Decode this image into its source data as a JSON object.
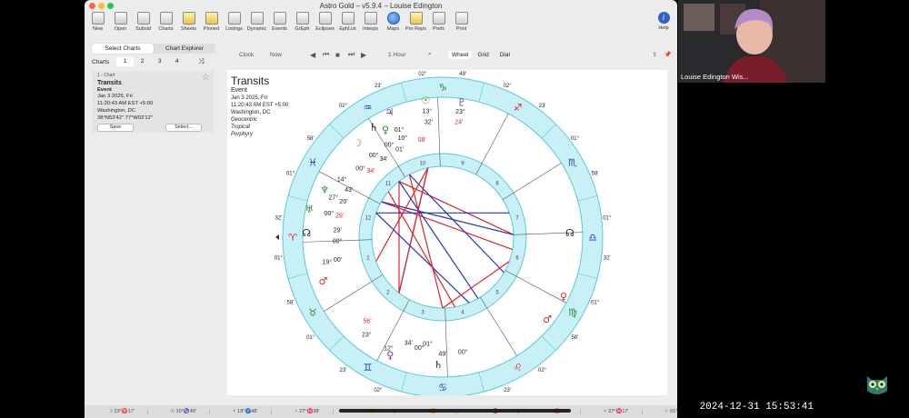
{
  "window": {
    "title": "Astro Gold – v5.9.4 – Louise Edington"
  },
  "toolbar": {
    "items": [
      {
        "label": "New",
        "icon": "new-chart-icon"
      },
      {
        "label": "Open",
        "icon": "open-icon"
      },
      {
        "label": "Subsid",
        "icon": "subsidiary-icon"
      },
      {
        "label": "Charts",
        "icon": "charts-icon"
      },
      {
        "label": "Sheets",
        "icon": "sheets-icon"
      },
      {
        "label": "Pinned",
        "icon": "pin-icon"
      },
      {
        "label": "Listings",
        "icon": "listings-icon"
      },
      {
        "label": "Dynamic",
        "icon": "dynamic-icon"
      },
      {
        "label": "Events",
        "icon": "events-icon"
      },
      {
        "label": "GrEph",
        "icon": "graphic-ephemeris-icon"
      },
      {
        "label": "Eclipses",
        "icon": "eclipses-icon"
      },
      {
        "label": "EphList",
        "icon": "ephemeris-list-icon"
      },
      {
        "label": "Interps",
        "icon": "interpretations-icon"
      },
      {
        "label": "Maps",
        "icon": "globe-icon"
      },
      {
        "label": "Pro Reps",
        "icon": "feather-icon"
      },
      {
        "label": "Prefs",
        "icon": "gear-icon"
      },
      {
        "label": "Print",
        "icon": "printer-icon"
      }
    ],
    "help": {
      "label": "Help",
      "glyph": "i"
    }
  },
  "sidebar": {
    "segments": [
      "Select Charts",
      "Chart Explorer"
    ],
    "charts_label": "Charts",
    "chart_numbers": [
      "1",
      "2",
      "3",
      "4"
    ],
    "card": {
      "header": "1 - Chart",
      "name": "Transits",
      "type": "Event",
      "date": "Jan 3 2025, Fri",
      "time": "11:20:43 AM EST +5:00",
      "place": "Washington, DC",
      "coords": "38°N53'42\" 77°W02'12\"",
      "save": "Save",
      "select": "Select..."
    }
  },
  "chart_toolbar": {
    "clock": "Clock",
    "now": "Now",
    "step": "1 Hour",
    "views": [
      "Wheel",
      "Grid",
      "Dial"
    ]
  },
  "info": {
    "title": "Transits",
    "type": "Event",
    "date": "Jan 3 2025, Fri",
    "time": "11:20:43 AM EST +5:00",
    "place": "Washington, DC",
    "zodiac1": "Geocentric",
    "zodiac2": "Tropical",
    "houses": "Porphyry"
  },
  "wheel": {
    "colors": {
      "ring": "#c7f1f6",
      "ring_stroke": "#5ec8d6",
      "red": "#d8262a",
      "blue": "#2236b8",
      "green": "#2b8a2b",
      "dark": "#222222"
    },
    "cusps": [
      "01°",
      "32'",
      "01°",
      "58'",
      "02°",
      "23'",
      "02°",
      "49'",
      "02°",
      "23'",
      "01°",
      "58'",
      "01°",
      "32'",
      "01°",
      "58'",
      "02°",
      "23'",
      "02°",
      "49'",
      "02°",
      "23'",
      "01°",
      "58'"
    ],
    "house_numbers": [
      "1",
      "2",
      "3",
      "4",
      "5",
      "6",
      "7",
      "8",
      "9",
      "10",
      "11",
      "12"
    ],
    "planet_labels": [
      "13°",
      "32'",
      "23°",
      "24'",
      "01°",
      "10°",
      "08'",
      "00°",
      "01'",
      "00°",
      "34'",
      "00°",
      "34'",
      "14°",
      "43'",
      "27°",
      "20'",
      "00°",
      "29'",
      "29'",
      "00°",
      "19°",
      "00'",
      "23°",
      "56'",
      "12°",
      "34'",
      "00°",
      "01°",
      "49'",
      "00°"
    ]
  },
  "statusbar": [
    "☽ 23°♈17'",
    "☉ 10°♑49'",
    "☿ 18°♐48'",
    "♀ 27°♓38'",
    "♂ 06°♌59'",
    "♃ 12°♊42'",
    "♄ 14°♓56'",
    "♅ 23°♉17'",
    "♆ 27°♓17'",
    "♇ 01°♒03'"
  ],
  "video": {
    "name": "Louise Edington Wis..."
  },
  "clock": "2024-12-31  15:53:41"
}
